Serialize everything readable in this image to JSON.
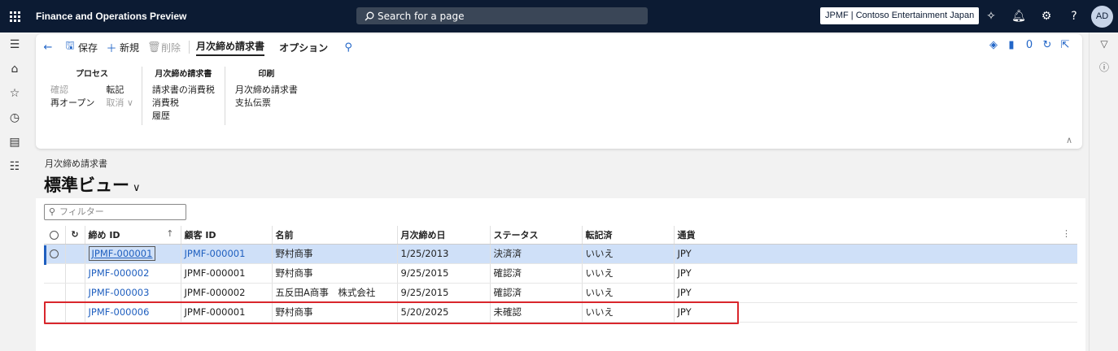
{
  "topbar": {
    "app_title": "Finance and Operations Preview",
    "search_placeholder": "Search for a page",
    "company": "JPMF | Contoso Entertainment Japan",
    "avatar": "AD",
    "icons": [
      "copilot-icon",
      "bell-icon",
      "gear-icon",
      "help-icon"
    ]
  },
  "toolbar": {
    "back_icon": "back-arrow-icon",
    "save": "保存",
    "new": "新規",
    "delete": "削除",
    "tabs": [
      "月次締め請求書",
      "オプション"
    ],
    "right_icons": [
      "diamond-icon",
      "office-icon",
      "attachment-count-icon",
      "refresh-icon",
      "popout-icon"
    ],
    "attachment_count": "0"
  },
  "groups": [
    {
      "title": "プロセス",
      "col1": [
        {
          "label": "確認",
          "disabled": true
        },
        {
          "label": "再オープン",
          "disabled": false
        }
      ],
      "col2": [
        {
          "label": "転記",
          "disabled": false
        },
        {
          "label": "取消 ∨",
          "disabled": true
        }
      ]
    },
    {
      "title": "月次締め請求書",
      "col1": [
        {
          "label": "請求書の消費税"
        },
        {
          "label": "消費税"
        },
        {
          "label": "履歴"
        }
      ]
    },
    {
      "title": "印刷",
      "col1": [
        {
          "label": "月次締め請求書"
        },
        {
          "label": "支払伝票"
        }
      ]
    }
  ],
  "page": {
    "caption": "月次締め請求書",
    "view_title": "標準ビュー",
    "filter_placeholder": "フィルター"
  },
  "grid": {
    "columns": [
      "締め ID",
      "顧客 ID",
      "名前",
      "月次締め日",
      "ステータス",
      "転記済",
      "通貨"
    ],
    "rows": [
      [
        "JPMF-000001",
        "JPMF-000001",
        "野村商事",
        "1/25/2013",
        "決済済",
        "いいえ",
        "JPY"
      ],
      [
        "JPMF-000002",
        "JPMF-000001",
        "野村商事",
        "9/25/2015",
        "確認済",
        "いいえ",
        "JPY"
      ],
      [
        "JPMF-000003",
        "JPMF-000002",
        "五反田A商事　株式会社",
        "9/25/2015",
        "確認済",
        "いいえ",
        "JPY"
      ],
      [
        "JPMF-000006",
        "JPMF-000001",
        "野村商事",
        "5/20/2025",
        "未確認",
        "いいえ",
        "JPY"
      ]
    ]
  },
  "colors": {
    "topbar": "#0c1b33",
    "link": "#1f5fbf",
    "selected_row": "#cfe0f8",
    "highlight": "#d9262c"
  }
}
